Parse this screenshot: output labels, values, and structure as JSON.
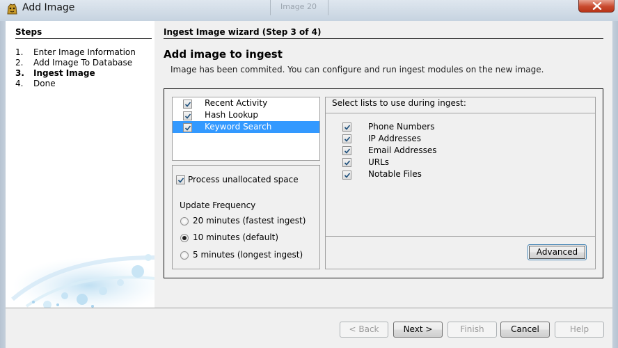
{
  "window": {
    "title": "Add Image",
    "background_tab": "Image 20",
    "icon": "autopsy-dog-icon",
    "close_icon": "close-icon"
  },
  "steps": {
    "title": "Steps",
    "items": [
      {
        "num": "1.",
        "label": "Enter Image Information",
        "current": false
      },
      {
        "num": "2.",
        "label": "Add Image To Database",
        "current": false
      },
      {
        "num": "3.",
        "label": "Ingest Image",
        "current": true
      },
      {
        "num": "4.",
        "label": "Done",
        "current": false
      }
    ]
  },
  "wizard": {
    "title": "Ingest Image wizard (Step 3 of 4)",
    "heading": "Add image to ingest",
    "subtext": "Image has been commited.  You can configure and run ingest modules on the new image."
  },
  "modules": [
    {
      "label": "Recent Activity",
      "checked": true,
      "selected": false
    },
    {
      "label": "Hash Lookup",
      "checked": true,
      "selected": false
    },
    {
      "label": "Keyword Search",
      "checked": true,
      "selected": true
    }
  ],
  "settings": {
    "process_unallocated_label": "Process unallocated space",
    "process_unallocated_checked": true,
    "update_frequency_label": "Update Frequency",
    "options": [
      {
        "label": "20 minutes (fastest ingest)",
        "selected": false
      },
      {
        "label": "10 minutes (default)",
        "selected": true
      },
      {
        "label": "5 minutes (longest ingest)",
        "selected": false
      }
    ]
  },
  "keyword_lists": {
    "title": "Select lists to use during ingest:",
    "items": [
      {
        "label": "Phone Numbers",
        "checked": true
      },
      {
        "label": "IP Addresses",
        "checked": true
      },
      {
        "label": "Email Addresses",
        "checked": true
      },
      {
        "label": "URLs",
        "checked": true
      },
      {
        "label": "Notable Files",
        "checked": true
      }
    ],
    "advanced_label": "Advanced"
  },
  "buttons": {
    "back": "< Back",
    "next": "Next >",
    "finish": "Finish",
    "cancel": "Cancel",
    "help": "Help"
  },
  "colors": {
    "selection": "#3399ff",
    "close": "#c94a2e"
  }
}
